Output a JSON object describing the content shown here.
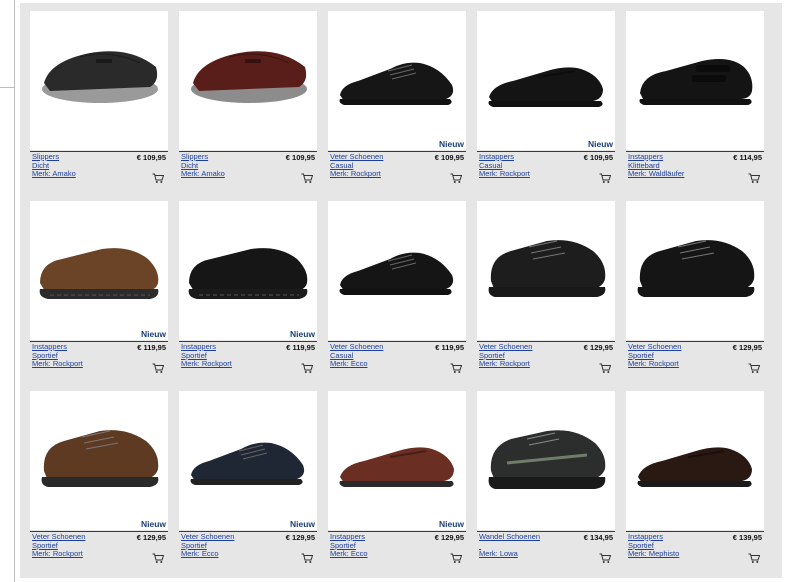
{
  "products": [
    {
      "type": "Slippers",
      "style": "Dicht",
      "brand": "Merk: Amako",
      "price": "€ 109,95",
      "badge": "",
      "leather": "#2a2a2a",
      "sole": "#9a9a9a",
      "shape": "mule"
    },
    {
      "type": "Slippers",
      "style": "Dicht",
      "brand": "Merk: Amako",
      "price": "€ 109,95",
      "badge": "",
      "leather": "#5a1e1a",
      "sole": "#8c8c8c",
      "shape": "mule"
    },
    {
      "type": "Veter Schoenen",
      "style": "Casual",
      "brand": "Merk: Rockport",
      "price": "€ 109,95",
      "badge": "Nieuw",
      "leather": "#161616",
      "sole": "#111111",
      "shape": "lace"
    },
    {
      "type": "Instappers",
      "style": "Casual",
      "brand": "Merk: Rockport",
      "price": "€ 109,95",
      "badge": "Nieuw",
      "leather": "#141414",
      "sole": "#111111",
      "shape": "slipon"
    },
    {
      "type": "Instappers",
      "style": "Klittebard",
      "brand": "Merk: Waldläufer",
      "price": "€ 114,95",
      "badge": "",
      "leather": "#141414",
      "sole": "#111111",
      "shape": "velcro"
    },
    {
      "type": "Instappers",
      "style": "Sportief",
      "brand": "Merk: Rockport",
      "price": "€ 119,95",
      "badge": "Nieuw",
      "leather": "#6b4326",
      "sole": "#2b2b2b",
      "shape": "sporty"
    },
    {
      "type": "Instappers",
      "style": "Sportief",
      "brand": "Merk: Rockport",
      "price": "€ 119,95",
      "badge": "Nieuw",
      "leather": "#161616",
      "sole": "#1b1b1b",
      "shape": "sporty"
    },
    {
      "type": "Veter Schoenen",
      "style": "Casual",
      "brand": "Merk: Ecco",
      "price": "€ 119,95",
      "badge": "",
      "leather": "#151515",
      "sole": "#111111",
      "shape": "lace"
    },
    {
      "type": "Veter Schoenen",
      "style": "Sportief",
      "brand": "Merk: Rockport",
      "price": "€ 129,95",
      "badge": "",
      "leather": "#1d1d1d",
      "sole": "#191919",
      "shape": "walker"
    },
    {
      "type": "Veter Schoenen",
      "style": "Sportief",
      "brand": "Merk: Rockport",
      "price": "€ 129,95",
      "badge": "",
      "leather": "#151515",
      "sole": "#151515",
      "shape": "walker"
    },
    {
      "type": "Veter Schoenen",
      "style": "Sportief",
      "brand": "Merk: Rockport",
      "price": "€ 129,95",
      "badge": "Nieuw",
      "leather": "#5e3a22",
      "sole": "#2a2a2a",
      "shape": "walker"
    },
    {
      "type": "Veter Schoenen",
      "style": "Sportief",
      "brand": "Merk: Ecco",
      "price": "€ 129,95",
      "badge": "Nieuw",
      "leather": "#1f2634",
      "sole": "#222222",
      "shape": "lace"
    },
    {
      "type": "Instappers",
      "style": "Sportief",
      "brand": "Merk: Ecco",
      "price": "€ 129,95",
      "badge": "Nieuw",
      "leather": "#6a2f22",
      "sole": "#2a2a2a",
      "shape": "slipon"
    },
    {
      "type": "Wandel Schoenen",
      "style": "",
      "brand": "Merk: Lowa",
      "price": "€ 134,95",
      "badge": "",
      "leather": "#2b2e2c",
      "sole": "#1a1a1a",
      "shape": "hiker"
    },
    {
      "type": "Instappers",
      "style": "Sportief",
      "brand": "Merk: Mephisto",
      "price": "€ 139,95",
      "badge": "",
      "leather": "#2a1813",
      "sole": "#1a1a1a",
      "shape": "slipon"
    }
  ]
}
